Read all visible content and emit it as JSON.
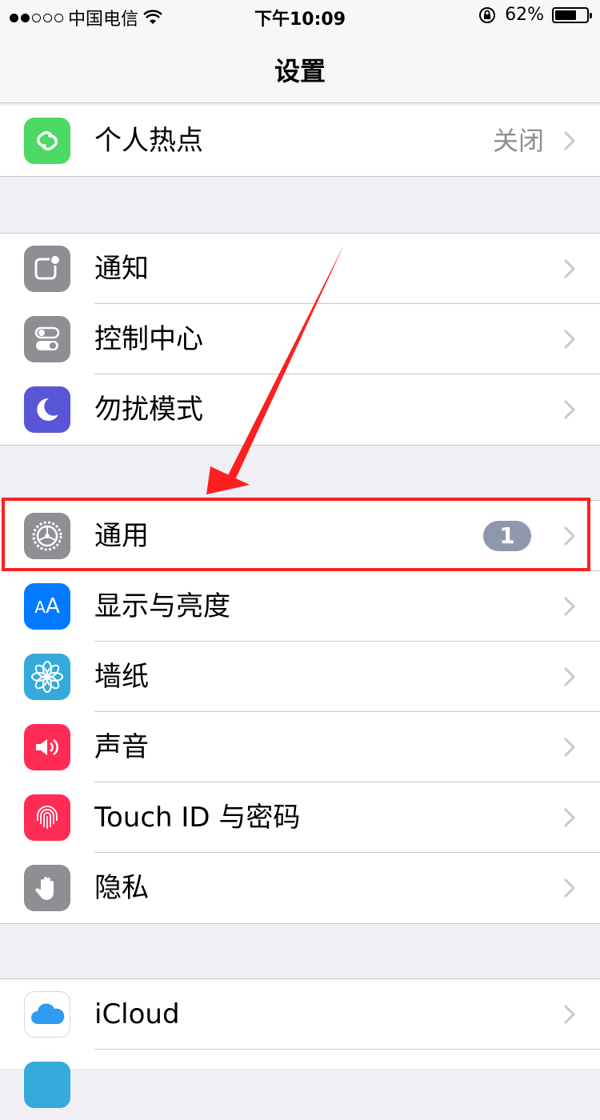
{
  "status": {
    "carrier": "中国电信",
    "time": "下午10:09",
    "battery_text": "62%",
    "battery_level": 0.62
  },
  "navbar": {
    "title": "设置"
  },
  "group1": [
    {
      "label": "个人热点",
      "value": "关闭",
      "icon": "hotspot-icon",
      "color": "#4cd964"
    }
  ],
  "group2": [
    {
      "label": "通知",
      "icon": "notifications-icon",
      "color": "#8e8e93"
    },
    {
      "label": "控制中心",
      "icon": "control-center-icon",
      "color": "#8e8e93"
    },
    {
      "label": "勿扰模式",
      "icon": "moon-icon",
      "color": "#5856d6"
    }
  ],
  "group3": [
    {
      "label": "通用",
      "badge": "1",
      "icon": "gear-icon",
      "color": "#8e8e93"
    },
    {
      "label": "显示与亮度",
      "icon": "aa-icon",
      "icon_text": "AA",
      "color": "#007aff"
    },
    {
      "label": "墙纸",
      "icon": "wallpaper-flower-icon",
      "color": "#34aadc"
    },
    {
      "label": "声音",
      "icon": "speaker-icon",
      "color": "#ff2d55"
    },
    {
      "label": "Touch ID 与密码",
      "icon": "fingerprint-icon",
      "color": "#ff2d55"
    },
    {
      "label": "隐私",
      "icon": "hand-icon",
      "color": "#8e8e93"
    }
  ],
  "group4": [
    {
      "label": "iCloud",
      "icon": "icloud-icon",
      "color": "#ffffff"
    }
  ],
  "annotation_color": "#ff1f1f"
}
